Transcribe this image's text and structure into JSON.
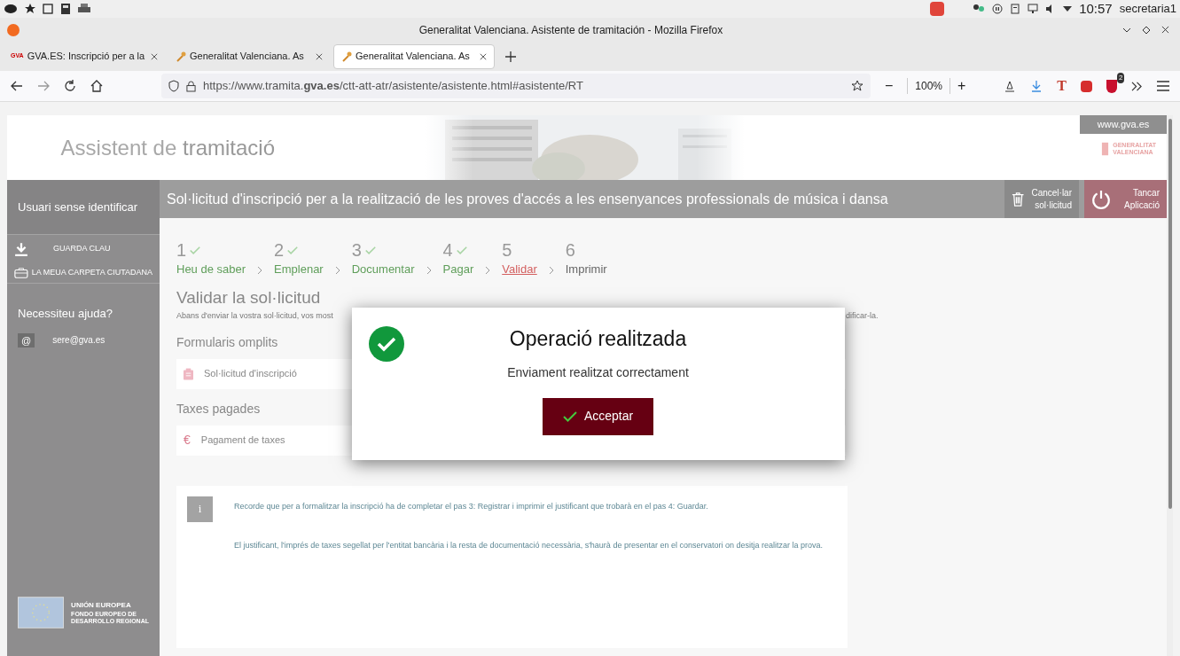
{
  "system_bar": {
    "clock": "10:57",
    "user": "secretaria1"
  },
  "window": {
    "title": "Generalitat Valenciana. Asistente de tramitación - Mozilla Firefox"
  },
  "tabs": [
    {
      "favicon": "GVA",
      "label": "GVA.ES: Inscripció per a la",
      "selected": false
    },
    {
      "label": "Generalitat Valenciana. As",
      "selected": false
    },
    {
      "label": "Generalitat Valenciana. As",
      "selected": true
    }
  ],
  "toolbar": {
    "url": "https://www.tramita.**gva.es**/ctt-att-atr/asistente/asistente.html#asistente/RT",
    "zoom": "100%",
    "zoom_out": "−",
    "zoom_in": "+",
    "badge": "2",
    "text_icon": "T"
  },
  "header": {
    "title_light": "Assistent de",
    "title_bold": "tramitació",
    "site": "www.gva.es",
    "logo": [
      "GENERALITAT",
      "VALENCIANA"
    ]
  },
  "sidebar": {
    "user": "Usuari sense identificar",
    "items": [
      {
        "kind": "download",
        "label": "GUARDA CLAU"
      },
      {
        "kind": "folder",
        "label": "LA MEUA CARPETA CIUTADANA"
      }
    ],
    "help": "Necessiteu ajuda?",
    "email_icon": "@",
    "email": "sere@gva.es",
    "eu": {
      "title": "UNIÓN EUROPEA",
      "lines": [
        "FONDO EUROPEO DE",
        "DESARROLLO REGIONAL"
      ]
    }
  },
  "page_title": "Sol·licitud d'inscripció per a la realització de les proves d'accés a les ensenyances professionals de música i dansa",
  "actions": [
    {
      "kind": "trash",
      "label": "Cancel·lar sol·licitud"
    },
    {
      "kind": "power",
      "label": "Tancar Aplicació"
    }
  ],
  "steps": [
    {
      "number": "1",
      "label": "Heu de saber",
      "done": true,
      "selected": false
    },
    {
      "number": "2",
      "label": "Emplenar",
      "done": true,
      "selected": false
    },
    {
      "number": "3",
      "label": "Documentar",
      "done": true,
      "selected": false
    },
    {
      "number": "4",
      "label": "Pagar",
      "done": true,
      "selected": false
    },
    {
      "number": "5",
      "label": "Validar",
      "done": false,
      "selected": true
    },
    {
      "number": "6",
      "label": "Imprimir",
      "done": false,
      "selected": false
    }
  ],
  "section": {
    "title": "Validar la sol·licitud",
    "intro_left": "Abans d'enviar la vostra sol·licitud, vos most",
    "intro_right": "dificar-la."
  },
  "groups": [
    {
      "title": "Formularis omplits",
      "kind": "form",
      "item": "Sol·licitud d'inscripció"
    },
    {
      "title": "Taxes pagades",
      "kind": "fee",
      "icon": "€",
      "item": "Pagament de taxes"
    }
  ],
  "info": {
    "icon": "i",
    "paragraphs": [
      "Recorde que per a formalitzar la inscripció ha de completar el pas 3: Registrar i imprimir el justificant que trobarà en el pas 4: Guardar.",
      "El justificant, l'imprés de taxes segellat per l'entitat bancària i la resta de documentació necessària, s'haurà de presentar en el conservatori on desitja realitzar la prova."
    ]
  },
  "dialog": {
    "title": "Operació realitzada",
    "message": "Enviament realitzat correctament",
    "button": "Acceptar"
  }
}
